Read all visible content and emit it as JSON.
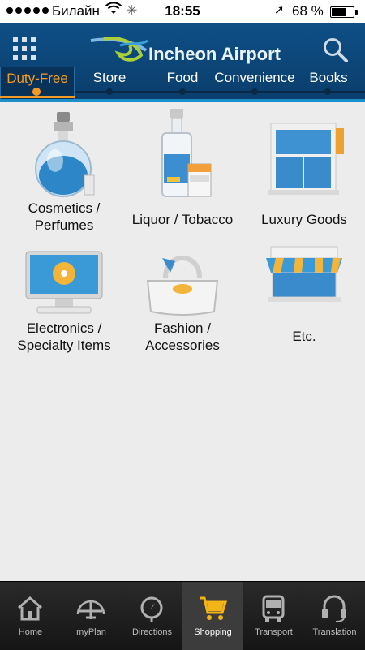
{
  "status_bar": {
    "carrier": "Билайн",
    "time": "18:55",
    "battery_percent": "68 %",
    "battery_level": 0.68
  },
  "header": {
    "title": "Incheon Airport",
    "icons": {
      "menu": "grid-menu-icon",
      "search": "search-icon"
    }
  },
  "tabs": [
    {
      "label": "Duty-Free",
      "active": true
    },
    {
      "label": "Store",
      "active": false
    },
    {
      "label": "Food",
      "active": false
    },
    {
      "label": "Convenience",
      "active": false
    },
    {
      "label": "Books",
      "active": false
    }
  ],
  "categories": [
    {
      "label_line1": "Cosmetics /",
      "label_line2": "Perfumes",
      "icon": "perfume-bottle-icon"
    },
    {
      "label_line1": "Liquor / Tobacco",
      "label_line2": "",
      "icon": "liquor-bottle-icon"
    },
    {
      "label_line1": "Luxury Goods",
      "label_line2": "",
      "icon": "luxury-store-icon"
    },
    {
      "label_line1": "Electronics /",
      "label_line2": "Specialty Items",
      "icon": "monitor-icon"
    },
    {
      "label_line1": "Fashion /",
      "label_line2": "Accessories",
      "icon": "handbag-icon"
    },
    {
      "label_line1": "Etc.",
      "label_line2": "",
      "icon": "shop-awning-icon"
    }
  ],
  "bottom_nav": [
    {
      "label": "Home",
      "icon": "home-icon",
      "active": false
    },
    {
      "label": "myPlan",
      "icon": "airplane-icon",
      "active": false
    },
    {
      "label": "Directions",
      "icon": "compass-icon",
      "active": false
    },
    {
      "label": "Shopping",
      "icon": "shopping-cart-icon",
      "active": true
    },
    {
      "label": "Transport",
      "icon": "bus-icon",
      "active": false
    },
    {
      "label": "Translation",
      "icon": "headset-icon",
      "active": false
    }
  ],
  "colors": {
    "header_bg": "#0e4f86",
    "accent": "#f39a26",
    "tabbar_bg": "#1c1c1c",
    "cart_yellow": "#f2b417"
  }
}
